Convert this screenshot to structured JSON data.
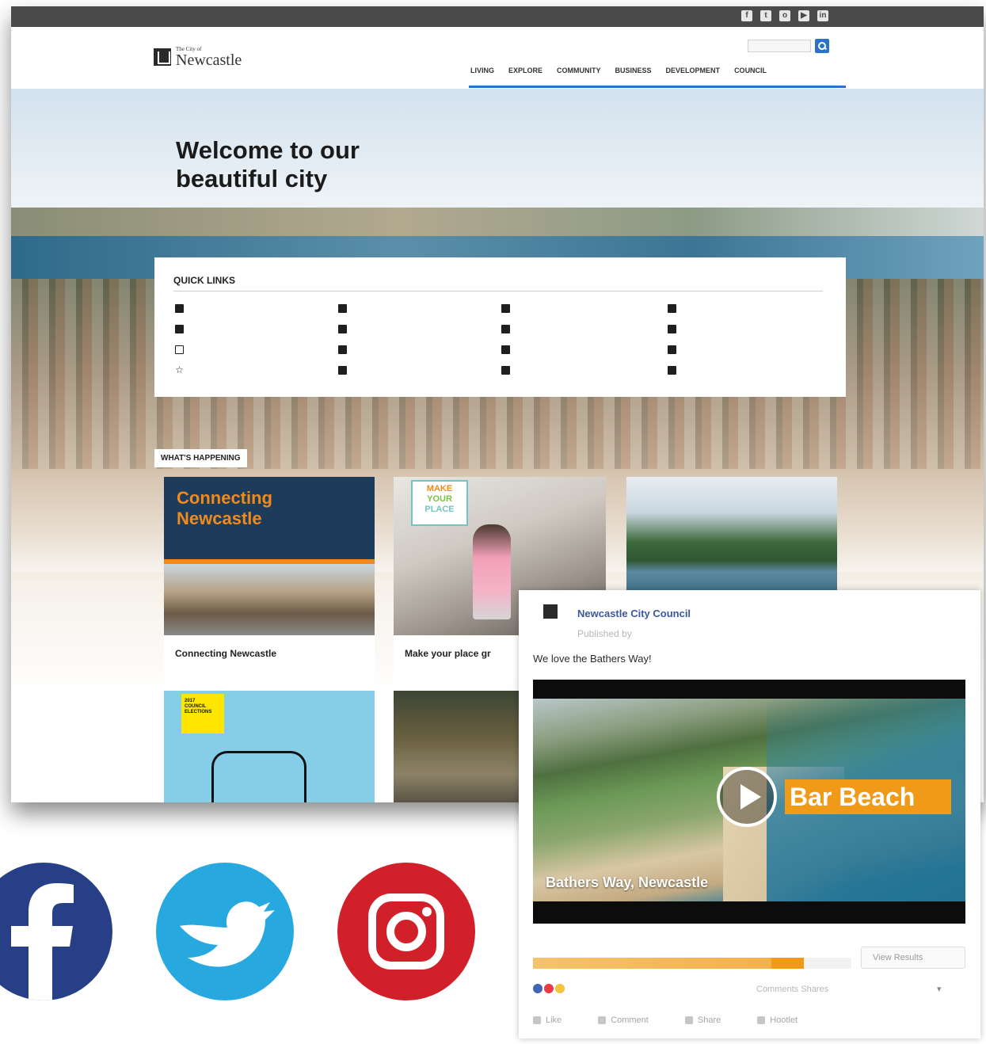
{
  "utility_bar": {
    "contact_text": "",
    "right_text": "",
    "social_icons": [
      "facebook-icon",
      "twitter-icon",
      "instagram-icon",
      "youtube-icon",
      "linkedin-icon"
    ]
  },
  "header": {
    "logo_small": "The City of",
    "logo_big": "Newcastle",
    "search_placeholder": "",
    "nav": [
      "LIVING",
      "EXPLORE",
      "COMMUNITY",
      "BUSINESS",
      "DEVELOPMENT",
      "COUNCIL"
    ],
    "accent": "#2a73c8"
  },
  "hero": {
    "title_line1": "Welcome to our",
    "title_line2": "beautiful city"
  },
  "quick_links": {
    "title": "QUICK LINKS",
    "items": [
      {
        "icon": "edit-icon",
        "label": ""
      },
      {
        "icon": "leaf-icon",
        "label": ""
      },
      {
        "icon": "building-icon",
        "label": ""
      },
      {
        "icon": "home-icon",
        "label": ""
      },
      {
        "icon": "document-icon",
        "label": ""
      },
      {
        "icon": "chat-icon",
        "label": ""
      },
      {
        "icon": "calendar-icon",
        "label": ""
      },
      {
        "icon": "book-icon",
        "label": ""
      },
      {
        "icon": "map-icon",
        "label": ""
      },
      {
        "icon": "person-icon",
        "label": ""
      },
      {
        "icon": "wrench-icon",
        "label": ""
      },
      {
        "icon": "flag-icon",
        "label": ""
      },
      {
        "icon": "star-icon",
        "label": ""
      },
      {
        "icon": "location-pin-icon",
        "label": ""
      },
      {
        "icon": "file-icon",
        "label": ""
      },
      {
        "icon": "library-icon",
        "label": ""
      }
    ]
  },
  "whats_happening": {
    "title": "WHAT'S HAPPENING",
    "cards": [
      {
        "title_line1": "Connecting",
        "title_line2": "Newcastle",
        "caption": "Connecting Newcastle"
      },
      {
        "logo_line1": "MAKE",
        "logo_line2": "YOUR",
        "logo_line3": "PLACE",
        "caption": "Make your place gr"
      },
      {
        "caption": ""
      },
      {
        "tag_line1": "2017",
        "tag_line2": "COUNCIL",
        "tag_line3": "ELECTIONS",
        "caption": ""
      },
      {
        "caption": ""
      }
    ]
  },
  "social_post": {
    "page_name": "Newcastle City Council",
    "meta": "Published by",
    "text": "We love the Bathers Way!",
    "video": {
      "overlay_title": "Bar Beach",
      "title": "Bathers Way, Newcastle",
      "time": ""
    },
    "poll_label": "",
    "poll_fraction": 0.85,
    "view_results": "View Results",
    "reaction_count": "",
    "counts": "Comments  Shares",
    "actions": [
      "Like",
      "Comment",
      "Share",
      "Hootlet"
    ],
    "colors": {
      "link": "#3b5998",
      "brand_orange": "#f09a18"
    }
  },
  "social_logos": [
    {
      "name": "facebook",
      "color": "#263f86"
    },
    {
      "name": "twitter",
      "color": "#27a9e0"
    },
    {
      "name": "instagram",
      "color": "#d1202a"
    }
  ]
}
